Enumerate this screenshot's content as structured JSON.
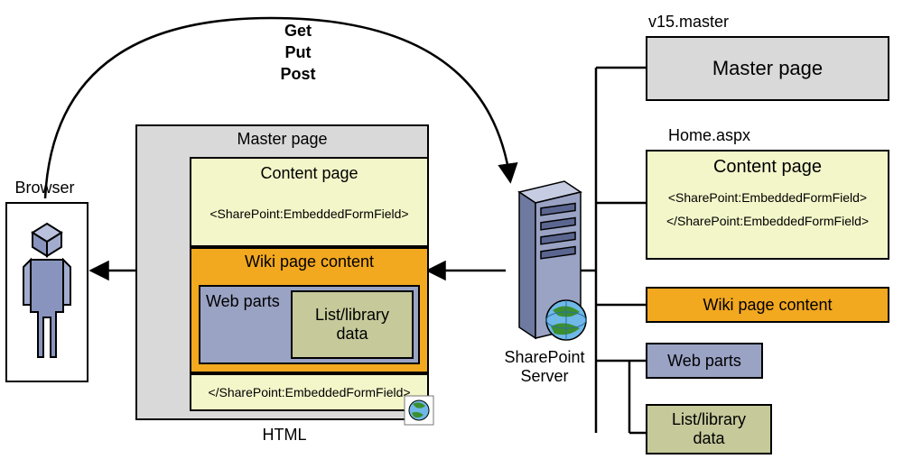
{
  "http": {
    "get": "Get",
    "put": "Put",
    "post": "Post"
  },
  "browser": {
    "label": "Browser"
  },
  "server": {
    "label": "SharePoint\nServer"
  },
  "center": {
    "master": "Master page",
    "content": "Content page",
    "open_tag": "<SharePoint:EmbeddedFormField>",
    "wiki": "Wiki page content",
    "webparts": "Web parts",
    "listlib": "List/library\ndata",
    "close_tag": "</SharePoint:EmbeddedFormField>",
    "html": "HTML"
  },
  "right": {
    "master_file": "v15.master",
    "master": "Master page",
    "content_file": "Home.aspx",
    "content": "Content page",
    "open_tag": "<SharePoint:EmbeddedFormField>",
    "close_tag": "</SharePoint:EmbeddedFormField>",
    "wiki": "Wiki page content",
    "webparts": "Web parts",
    "listlib": "List/library\ndata"
  }
}
